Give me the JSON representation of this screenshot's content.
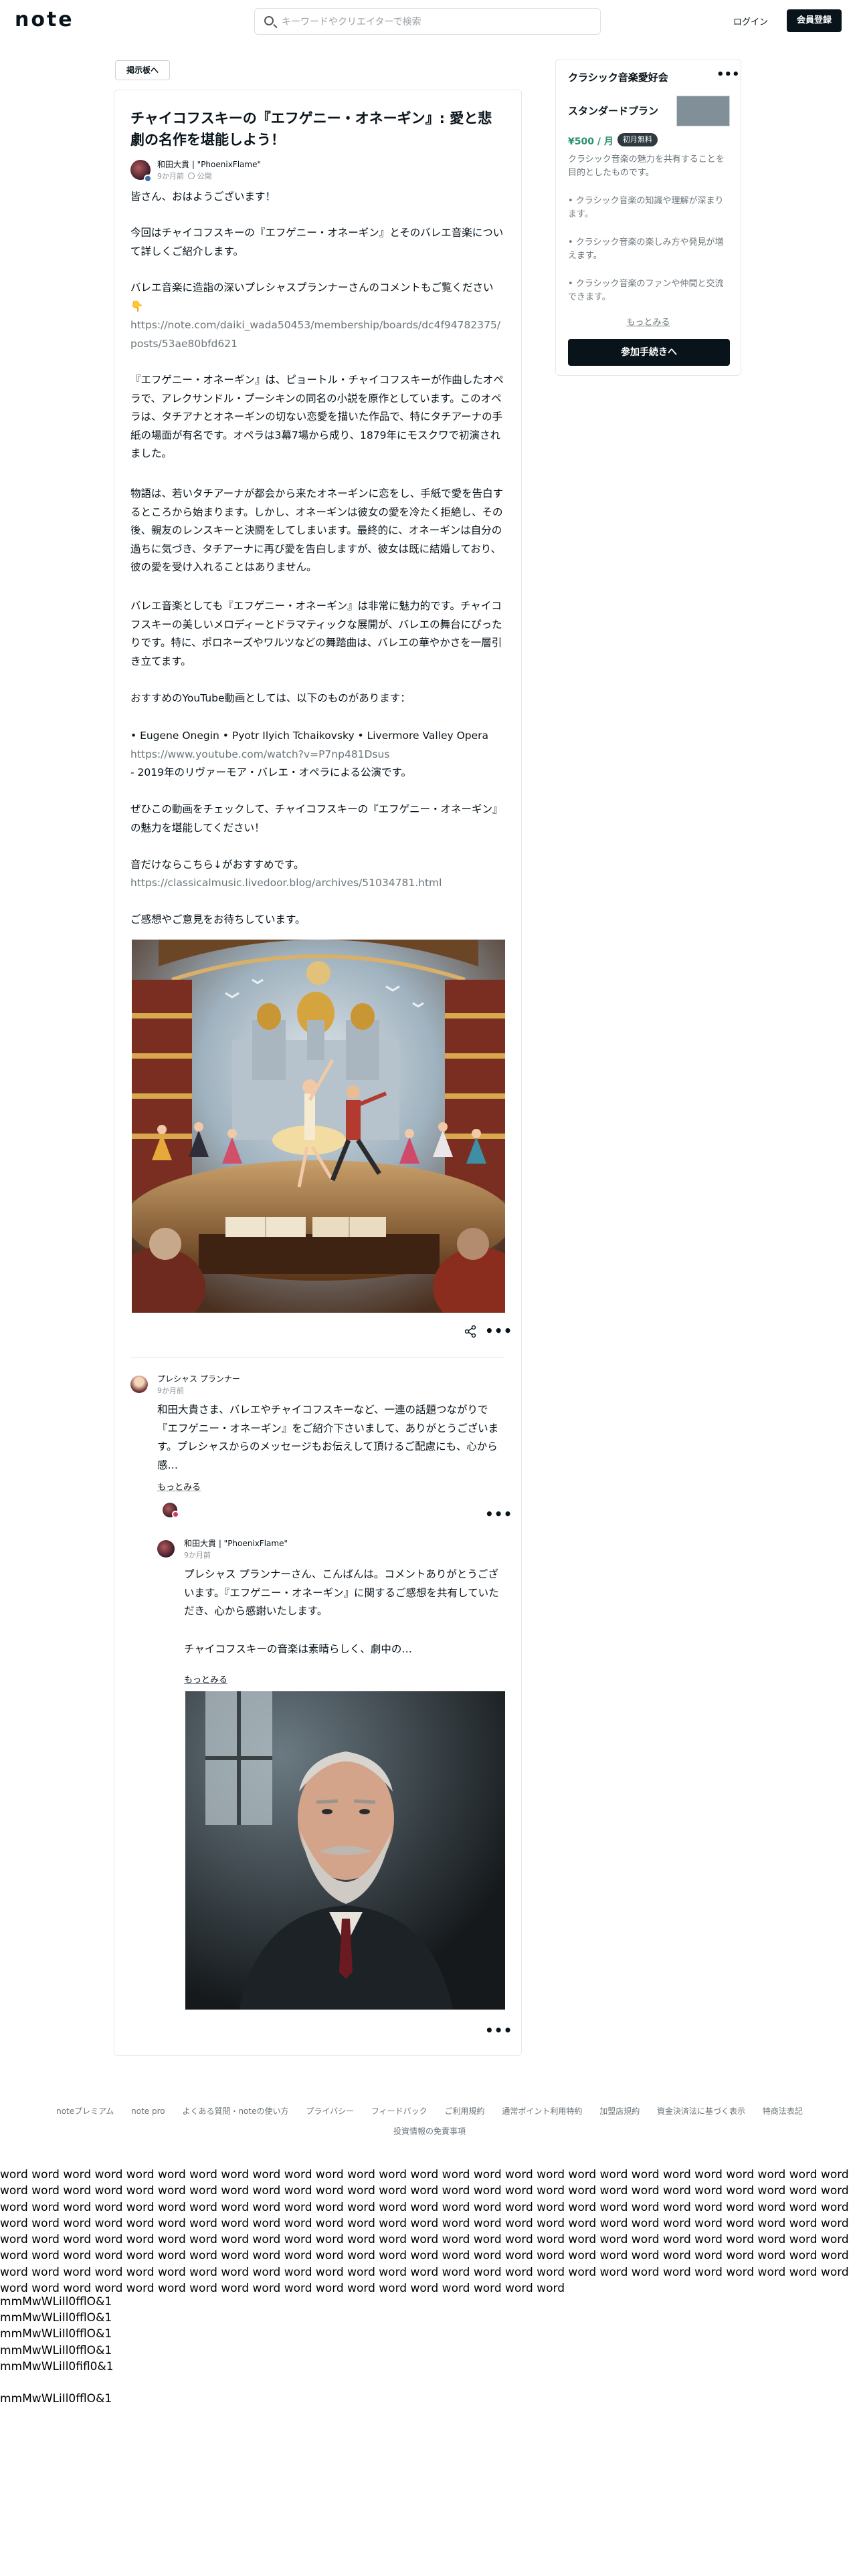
{
  "header": {
    "logo": "note",
    "search_placeholder": "キーワードやクリエイターで検索",
    "login_label": "ログイン",
    "signup_label": "会員登録"
  },
  "back_label": "掲示板へ",
  "article": {
    "title": "チャイコフスキーの『エフゲニー・オネーギン』: 愛と悲劇の名作を堪能しよう！",
    "author_name": "和田大貴 | \"PhoenixFlame\"",
    "time": "9か月前",
    "visibility": "公開",
    "paragraphs": [
      "皆さん、おはようございます！",
      "今回はチャイコフスキーの『エフゲニー・オネーギン』とそのバレエ音楽について詳しくご紹介します。",
      "バレエ音楽に造詣の深いプレシャスプランナーさんのコメントもご覧ください👇",
      "https://note.com/daiki_wada50453/membership/boards/dc4f94782375/posts/53ae80bfd621",
      "『エフゲニー・オネーギン』は、ピョートル・チャイコフスキーが作曲したオペラで、アレクサンドル・プーシキンの同名の小説を原作としています。このオペラは、タチアナとオネーギンの切ない恋愛を描いた作品で、特にタチアーナの手紙の場面が有名です。オペラは3幕7場から成り、1879年にモスクワで初演されました。",
      "物語は、若いタチアーナが都会から来たオネーギンに恋をし、手紙で愛を告白するところから始まります。しかし、オネーギンは彼女の愛を冷たく拒絶し、その後、親友のレンスキーと決闘をしてしまいます。最終的に、オネーギンは自分の過ちに気づき、タチアーナに再び愛を告白しますが、彼女は既に結婚しており、彼の愛を受け入れることはありません。",
      "バレエ音楽としても『エフゲニー・オネーギン』は非常に魅力的です。チャイコフスキーの美しいメロディーとドラマティックな展開が、バレエの舞台にぴったりです。特に、ポロネーズやワルツなどの舞踏曲は、バレエの華やかさを一層引き立てます。",
      "おすすめのYouTube動画としては、以下のものがあります：",
      "• Eugene Onegin • Pyotr Ilyich Tchaikovsky • Livermore Valley Opera",
      "https://www.youtube.com/watch?v=P7np481Dsus",
      "- 2019年のリヴァーモア・バレエ・オペラによる公演です。",
      "ぜひこの動画をチェックして、チャイコフスキーの『エフゲニー・オネーギン』の魅力を堪能してください！",
      "音だけならこちら↓がおすすめです。",
      "https://classicalmusic.livedoor.blog/archives/51034781.html",
      "ご感想やご意見をお待ちしています。"
    ]
  },
  "comments": {
    "first": {
      "name": "プレシャス プランナー",
      "time": "9か月前",
      "text": "和田大貴さま、バレエやチャイコフスキーなど、一連の話題つながりで『エフゲニー・オネーギン』をご紹介下さいまして、ありがとうございます。プレシャスからのメッセージもお伝えして頂けるご配慮にも、心から感…",
      "more": "もっとみる"
    },
    "reply": {
      "name": "和田大貴 | \"PhoenixFlame\"",
      "time": "9か月前",
      "text1": "プレシャス プランナーさん、こんばんは。コメントありがとうございます。『エフゲニー・オネーギン』に関するご感想を共有していただき、心から感謝いたします。",
      "text2": "チャイコフスキーの音楽は素晴らしく、劇中の…",
      "more": "もっとみる"
    }
  },
  "sidebar": {
    "title": "クラシック音楽愛好会",
    "plan": "スタンダードプラン",
    "price": "¥500 / 月",
    "badge": "初月無料",
    "desc": "クラシック音楽の魅力を共有することを目的としたものです。",
    "items": [
      "• クラシック音楽の知識や理解が深まります。",
      "• クラシック音楽の楽しみ方や発見が増えます。",
      "• クラシック音楽のファンや仲間と交流できます。"
    ],
    "more": "もっとみる",
    "join": "参加手続きへ"
  },
  "footer": {
    "links": [
      "noteプレミアム",
      "note pro",
      "よくある質問・noteの使い方",
      "プライバシー",
      "フィードバック",
      "ご利用規約",
      "通常ポイント利用特約",
      "加盟店規約",
      "資金決済法に基づく表示",
      "特商法表記"
    ],
    "link2": "投資情報の免責事項"
  },
  "filler": {
    "words": "word word word word word word word word word word word word word word word word word word word word word word word word word word word word word word word word word word word word word word word word word word word word word word word word word word word word word word word word word word word word word word word word word word word word word word word word word word word word word word word word word word word word word word word word word word word word word word word word word word word word word word word word word word word word word word word word word word word word word word word word word word word word word word word word word word word word word word word word word word word word word word word word word word word word word word word word word word word word word word word word word word word word word word word word word word word word word word word word word word word word word word word word word word word word word word word word word word word word word word word word word word word word word word word",
    "lines": [
      "mmMwWLiIl0fflO&1",
      "mmMwWLiIl0fflO&1",
      "mmMwWLiIl0fflO&1",
      "mmMwWLiIl0fflO&1",
      "mmMwWLiIl0fifl0&1",
      "",
      "mmMwWLiIl0fflO&1"
    ]
  }
}
